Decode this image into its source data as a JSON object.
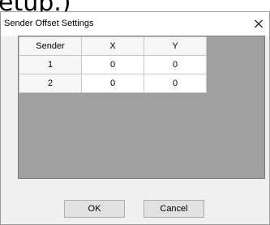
{
  "background": {
    "partial_text": "etup.)"
  },
  "dialog": {
    "title": "Sender Offset Settings",
    "close_glyph": "×"
  },
  "grid": {
    "columns": [
      "Sender",
      "X",
      "Y"
    ],
    "rows": [
      {
        "sender": "1",
        "x": "0",
        "y": "0"
      },
      {
        "sender": "2",
        "x": "0",
        "y": "0"
      }
    ]
  },
  "buttons": {
    "ok_label": "OK",
    "cancel_label": "Cancel"
  },
  "colors": {
    "grid_background": "#a0a0a0",
    "dialog_background": "#f0f0f0"
  }
}
